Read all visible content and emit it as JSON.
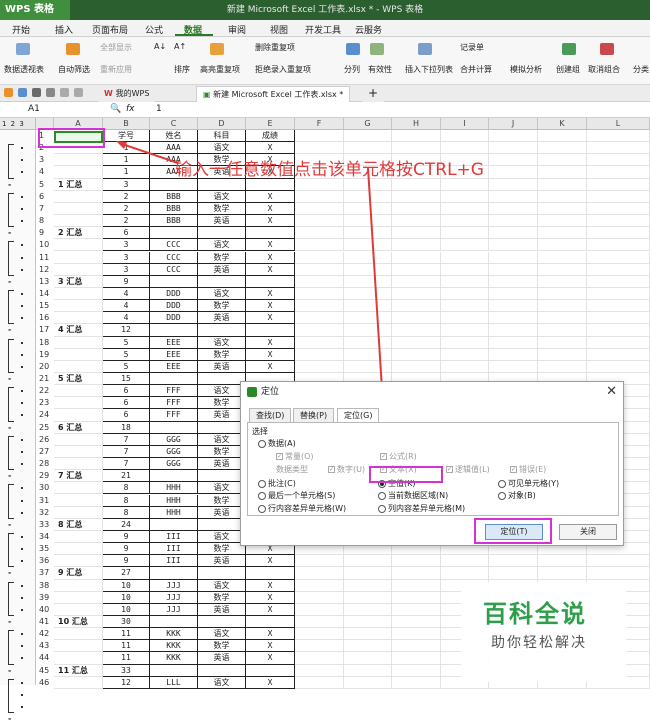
{
  "app": {
    "logo": "WPS 表格",
    "window_title": "新建 Microsoft Excel 工作表.xlsx * - WPS 表格"
  },
  "menu": [
    "开始",
    "插入",
    "页面布局",
    "公式",
    "数据",
    "审阅",
    "视图",
    "开发工具",
    "云服务"
  ],
  "ribbon": {
    "pivot": "数据透视表",
    "autofilter": "自动筛选",
    "show_all": "全部显示",
    "reapply": "重新应用",
    "sort": "排序",
    "highlight_dup": "高亮重复项",
    "delete_dup": "删除重复项",
    "reject_dup": "拒绝录入重复项",
    "split": "分列",
    "validity": "有效性",
    "insert_dropdown": "插入下拉列表",
    "consolidate": "合并计算",
    "simulate": "模拟分析",
    "record": "记录单",
    "group": "创建组",
    "ungroup": "取消组合",
    "subtotal": "分类"
  },
  "tabs": {
    "my_wps": "我的WPS",
    "doc": "新建 Microsoft Excel 工作表.xlsx *",
    "add": "+"
  },
  "formula": {
    "cell_ref": "A1",
    "fx": "fx",
    "value": "1"
  },
  "outline_levels": "1 2 3",
  "columns": [
    "A",
    "B",
    "C",
    "D",
    "E",
    "F",
    "G",
    "H",
    "I",
    "J",
    "K",
    "L"
  ],
  "rows": [
    {
      "n": "1",
      "a": "1",
      "b": "学号",
      "c": "姓名",
      "d": "科目",
      "e": "成绩"
    },
    {
      "n": "2",
      "a": "",
      "b": "1",
      "c": "AAA",
      "d": "语文",
      "e": "X"
    },
    {
      "n": "3",
      "a": "",
      "b": "1",
      "c": "AAA",
      "d": "数学",
      "e": "X"
    },
    {
      "n": "4",
      "a": "",
      "b": "1",
      "c": "AAA",
      "d": "英语",
      "e": "X"
    },
    {
      "n": "5",
      "a": "1 汇总",
      "b": "3",
      "c": "",
      "d": "",
      "e": ""
    },
    {
      "n": "6",
      "a": "",
      "b": "2",
      "c": "BBB",
      "d": "语文",
      "e": "X"
    },
    {
      "n": "7",
      "a": "",
      "b": "2",
      "c": "BBB",
      "d": "数学",
      "e": "X"
    },
    {
      "n": "8",
      "a": "",
      "b": "2",
      "c": "BBB",
      "d": "英语",
      "e": "X"
    },
    {
      "n": "9",
      "a": "2 汇总",
      "b": "6",
      "c": "",
      "d": "",
      "e": ""
    },
    {
      "n": "10",
      "a": "",
      "b": "3",
      "c": "CCC",
      "d": "语文",
      "e": "X"
    },
    {
      "n": "11",
      "a": "",
      "b": "3",
      "c": "CCC",
      "d": "数学",
      "e": "X"
    },
    {
      "n": "12",
      "a": "",
      "b": "3",
      "c": "CCC",
      "d": "英语",
      "e": "X"
    },
    {
      "n": "13",
      "a": "3 汇总",
      "b": "9",
      "c": "",
      "d": "",
      "e": ""
    },
    {
      "n": "14",
      "a": "",
      "b": "4",
      "c": "DDD",
      "d": "语文",
      "e": "X"
    },
    {
      "n": "15",
      "a": "",
      "b": "4",
      "c": "DDD",
      "d": "数学",
      "e": "X"
    },
    {
      "n": "16",
      "a": "",
      "b": "4",
      "c": "DDD",
      "d": "英语",
      "e": "X"
    },
    {
      "n": "17",
      "a": "4 汇总",
      "b": "12",
      "c": "",
      "d": "",
      "e": ""
    },
    {
      "n": "18",
      "a": "",
      "b": "5",
      "c": "EEE",
      "d": "语文",
      "e": "X"
    },
    {
      "n": "19",
      "a": "",
      "b": "5",
      "c": "EEE",
      "d": "数学",
      "e": "X"
    },
    {
      "n": "20",
      "a": "",
      "b": "5",
      "c": "EEE",
      "d": "英语",
      "e": "X"
    },
    {
      "n": "21",
      "a": "5 汇总",
      "b": "15",
      "c": "",
      "d": "",
      "e": ""
    },
    {
      "n": "22",
      "a": "",
      "b": "6",
      "c": "FFF",
      "d": "语文",
      "e": "X"
    },
    {
      "n": "23",
      "a": "",
      "b": "6",
      "c": "FFF",
      "d": "数学",
      "e": "X"
    },
    {
      "n": "24",
      "a": "",
      "b": "6",
      "c": "FFF",
      "d": "英语",
      "e": "X"
    },
    {
      "n": "25",
      "a": "6 汇总",
      "b": "18",
      "c": "",
      "d": "",
      "e": ""
    },
    {
      "n": "26",
      "a": "",
      "b": "7",
      "c": "GGG",
      "d": "语文",
      "e": "X"
    },
    {
      "n": "27",
      "a": "",
      "b": "7",
      "c": "GGG",
      "d": "数学",
      "e": "X"
    },
    {
      "n": "28",
      "a": "",
      "b": "7",
      "c": "GGG",
      "d": "英语",
      "e": "X"
    },
    {
      "n": "29",
      "a": "7 汇总",
      "b": "21",
      "c": "",
      "d": "",
      "e": ""
    },
    {
      "n": "30",
      "a": "",
      "b": "8",
      "c": "HHH",
      "d": "语文",
      "e": "X"
    },
    {
      "n": "31",
      "a": "",
      "b": "8",
      "c": "HHH",
      "d": "数学",
      "e": "X"
    },
    {
      "n": "32",
      "a": "",
      "b": "8",
      "c": "HHH",
      "d": "英语",
      "e": "X"
    },
    {
      "n": "33",
      "a": "8 汇总",
      "b": "24",
      "c": "",
      "d": "",
      "e": ""
    },
    {
      "n": "34",
      "a": "",
      "b": "9",
      "c": "III",
      "d": "语文",
      "e": "X"
    },
    {
      "n": "35",
      "a": "",
      "b": "9",
      "c": "III",
      "d": "数学",
      "e": "X"
    },
    {
      "n": "36",
      "a": "",
      "b": "9",
      "c": "III",
      "d": "英语",
      "e": "X"
    },
    {
      "n": "37",
      "a": "9 汇总",
      "b": "27",
      "c": "",
      "d": "",
      "e": ""
    },
    {
      "n": "38",
      "a": "",
      "b": "10",
      "c": "JJJ",
      "d": "语文",
      "e": "X"
    },
    {
      "n": "39",
      "a": "",
      "b": "10",
      "c": "JJJ",
      "d": "数学",
      "e": "X"
    },
    {
      "n": "40",
      "a": "",
      "b": "10",
      "c": "JJJ",
      "d": "英语",
      "e": "X"
    },
    {
      "n": "41",
      "a": "10 汇总",
      "b": "30",
      "c": "",
      "d": "",
      "e": ""
    },
    {
      "n": "42",
      "a": "",
      "b": "11",
      "c": "KKK",
      "d": "语文",
      "e": "X"
    },
    {
      "n": "43",
      "a": "",
      "b": "11",
      "c": "KKK",
      "d": "数学",
      "e": "X"
    },
    {
      "n": "44",
      "a": "",
      "b": "11",
      "c": "KKK",
      "d": "英语",
      "e": "X"
    },
    {
      "n": "45",
      "a": "11 汇总",
      "b": "33",
      "c": "",
      "d": "",
      "e": ""
    },
    {
      "n": "46",
      "a": "",
      "b": "12",
      "c": "LLL",
      "d": "语文",
      "e": "X"
    }
  ],
  "annotation": "输入一任意数值点击该单元格按CTRL+G",
  "dialog": {
    "title": "定位",
    "tabs": [
      "查找(D)",
      "替换(P)",
      "定位(G)"
    ],
    "section": "选择",
    "data": "数据(A)",
    "constant": "常量(O)",
    "formula": "公式(R)",
    "data_types": "数据类型",
    "number": "数字(U)",
    "text": "文本(X)",
    "logical": "逻辑值(L)",
    "error": "错误(E)",
    "comment": "批注(C)",
    "blank": "空值(K)",
    "visible": "可见单元格(Y)",
    "last_cell": "最后一个单元格(S)",
    "current_region": "当前数据区域(N)",
    "object": "对象(B)",
    "row_diff": "行内容差异单元格(W)",
    "col_diff": "列内容差异单元格(M)",
    "ok": "定位(T)",
    "close": "关闭"
  },
  "watermark": {
    "brand": "百科全说",
    "slogan": "助你轻松解决"
  },
  "colors": {
    "accent": "#2a8a2a",
    "highlight": "#d631d6",
    "annotation": "#e03a3a"
  }
}
